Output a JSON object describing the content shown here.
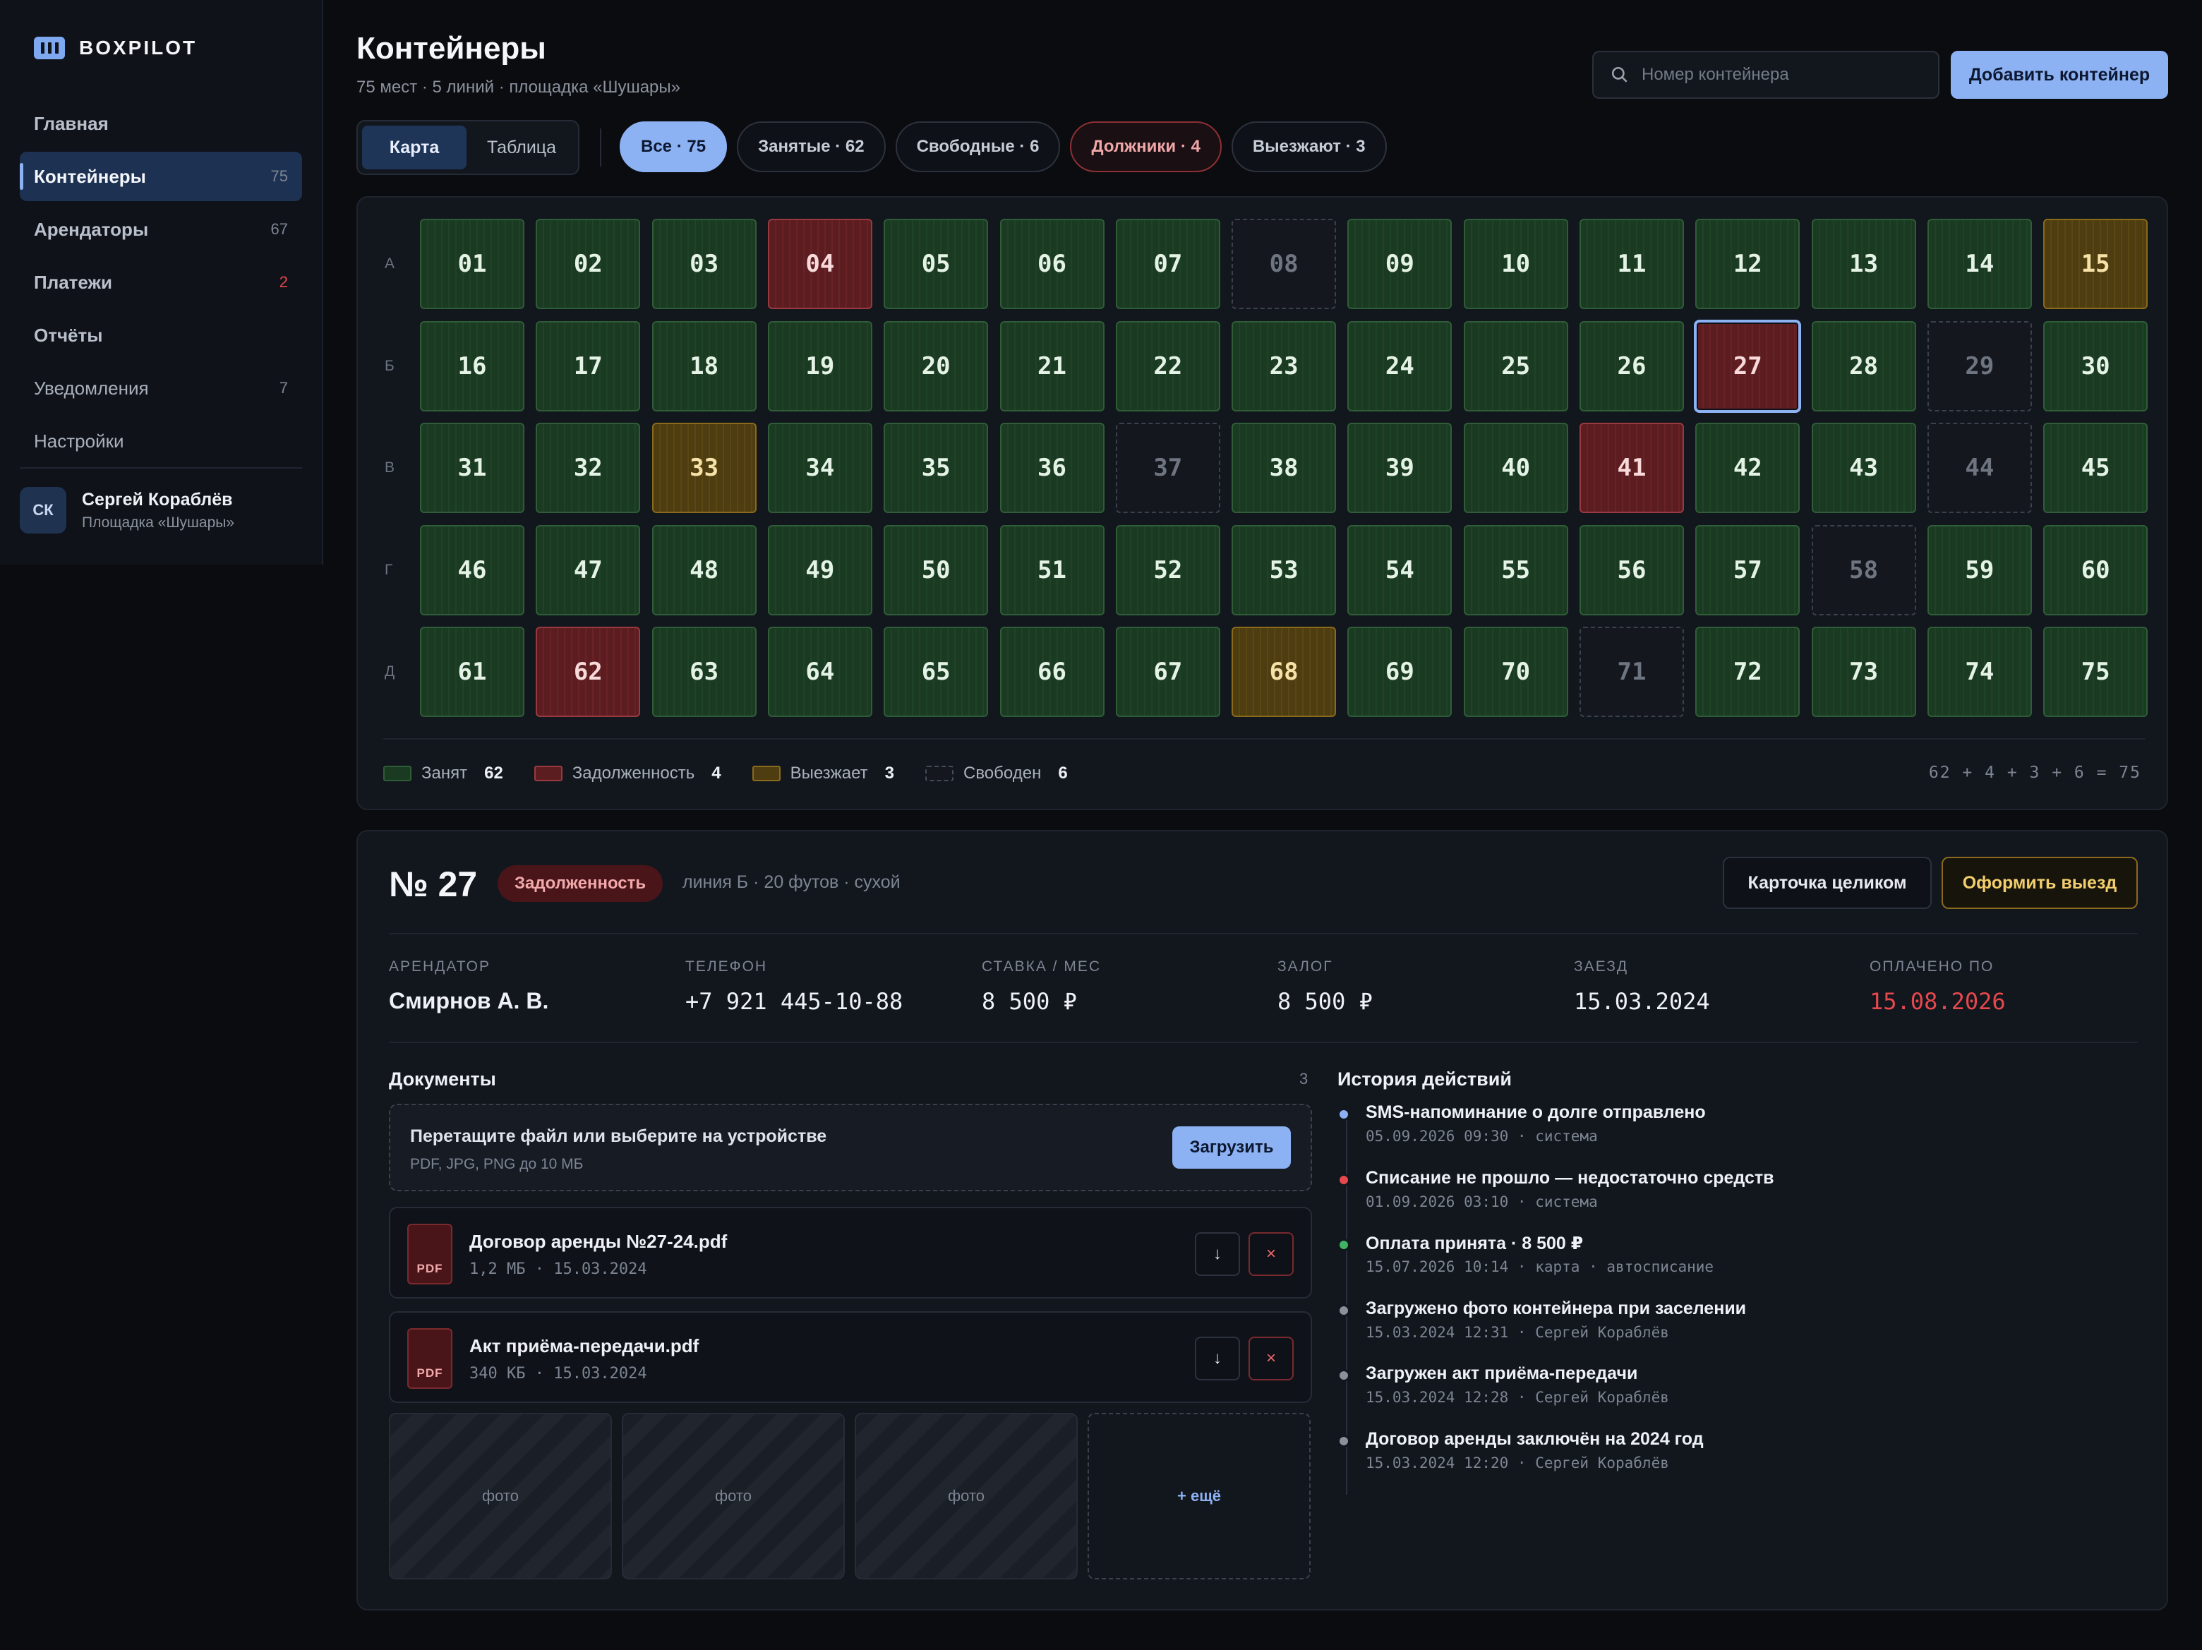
{
  "brand": {
    "name": "BOXPILOT"
  },
  "sidebar": {
    "items": [
      {
        "label": "Главная",
        "count": ""
      },
      {
        "label": "Контейнеры",
        "count": "75"
      },
      {
        "label": "Арендаторы",
        "count": "67"
      },
      {
        "label": "Платежи",
        "count": "2"
      },
      {
        "label": "Отчёты",
        "count": ""
      },
      {
        "label": "Уведомления",
        "count": "7"
      },
      {
        "label": "Настройки",
        "count": ""
      }
    ],
    "user": {
      "initials": "СК",
      "name": "Сергей Кораблёв",
      "site": "Площадка «Шушары»"
    }
  },
  "header": {
    "title": "Контейнеры",
    "subtitle": "75 мест · 5 линий · площадка «Шушары»",
    "search_placeholder": "Номер контейнера",
    "add_label": "Добавить контейнер"
  },
  "toolbar": {
    "view_map": "Карта",
    "view_table": "Таблица",
    "filters": [
      "Все · 75",
      "Занятые · 62",
      "Свободные · 6",
      "Должники · 4",
      "Выезжают · 3"
    ]
  },
  "map": {
    "rows": [
      {
        "label": "А",
        "cells": [
          [
            "01",
            "occ"
          ],
          [
            "02",
            "occ"
          ],
          [
            "03",
            "occ"
          ],
          [
            "04",
            "debt"
          ],
          [
            "05",
            "occ"
          ],
          [
            "06",
            "occ"
          ],
          [
            "07",
            "occ"
          ],
          [
            "08",
            "free"
          ],
          [
            "09",
            "occ"
          ],
          [
            "10",
            "occ"
          ],
          [
            "11",
            "occ"
          ],
          [
            "12",
            "occ"
          ],
          [
            "13",
            "occ"
          ],
          [
            "14",
            "occ"
          ],
          [
            "15",
            "leave"
          ]
        ]
      },
      {
        "label": "Б",
        "cells": [
          [
            "16",
            "occ"
          ],
          [
            "17",
            "occ"
          ],
          [
            "18",
            "occ"
          ],
          [
            "19",
            "occ"
          ],
          [
            "20",
            "occ"
          ],
          [
            "21",
            "occ"
          ],
          [
            "22",
            "occ"
          ],
          [
            "23",
            "occ"
          ],
          [
            "24",
            "occ"
          ],
          [
            "25",
            "occ"
          ],
          [
            "26",
            "occ"
          ],
          [
            "27",
            "debt"
          ],
          [
            "28",
            "occ"
          ],
          [
            "29",
            "free"
          ],
          [
            "30",
            "occ"
          ]
        ]
      },
      {
        "label": "В",
        "cells": [
          [
            "31",
            "occ"
          ],
          [
            "32",
            "occ"
          ],
          [
            "33",
            "leave"
          ],
          [
            "34",
            "occ"
          ],
          [
            "35",
            "occ"
          ],
          [
            "36",
            "occ"
          ],
          [
            "37",
            "free"
          ],
          [
            "38",
            "occ"
          ],
          [
            "39",
            "occ"
          ],
          [
            "40",
            "occ"
          ],
          [
            "41",
            "debt"
          ],
          [
            "42",
            "occ"
          ],
          [
            "43",
            "occ"
          ],
          [
            "44",
            "free"
          ],
          [
            "45",
            "occ"
          ]
        ]
      },
      {
        "label": "Г",
        "cells": [
          [
            "46",
            "occ"
          ],
          [
            "47",
            "occ"
          ],
          [
            "48",
            "occ"
          ],
          [
            "49",
            "occ"
          ],
          [
            "50",
            "occ"
          ],
          [
            "51",
            "occ"
          ],
          [
            "52",
            "occ"
          ],
          [
            "53",
            "occ"
          ],
          [
            "54",
            "occ"
          ],
          [
            "55",
            "occ"
          ],
          [
            "56",
            "occ"
          ],
          [
            "57",
            "occ"
          ],
          [
            "58",
            "free"
          ],
          [
            "59",
            "occ"
          ],
          [
            "60",
            "occ"
          ]
        ]
      },
      {
        "label": "Д",
        "cells": [
          [
            "61",
            "occ"
          ],
          [
            "62",
            "debt"
          ],
          [
            "63",
            "occ"
          ],
          [
            "64",
            "occ"
          ],
          [
            "65",
            "occ"
          ],
          [
            "66",
            "occ"
          ],
          [
            "67",
            "occ"
          ],
          [
            "68",
            "leave"
          ],
          [
            "69",
            "occ"
          ],
          [
            "70",
            "occ"
          ],
          [
            "71",
            "free"
          ],
          [
            "72",
            "occ"
          ],
          [
            "73",
            "occ"
          ],
          [
            "74",
            "occ"
          ],
          [
            "75",
            "occ"
          ]
        ]
      }
    ],
    "selected": "27",
    "legend": [
      {
        "label": "Занят",
        "count": "62",
        "kind": "occ"
      },
      {
        "label": "Задолженность",
        "count": "4",
        "kind": "debt"
      },
      {
        "label": "Выезжает",
        "count": "3",
        "kind": "leave"
      },
      {
        "label": "Свободен",
        "count": "6",
        "kind": "free"
      }
    ],
    "sum": "62 + 4 + 3 + 6 = 75"
  },
  "colors": {
    "accent": "#8db2f4",
    "occupied": "#1b3a22",
    "debt": "#5c1d21",
    "leaving": "#4e3d10",
    "danger": "#e5484d"
  },
  "detail": {
    "number": "№ 27",
    "status": "Задолженность",
    "meta": "линия Б · 20 футов · сухой",
    "btn_card": "Карточка целиком",
    "btn_exit": "Оформить выезд",
    "fields": [
      {
        "label": "АРЕНДАТОР",
        "value": "Смирнов А. В."
      },
      {
        "label": "ТЕЛЕФОН",
        "value": "+7 921 445-10-88"
      },
      {
        "label": "СТАВКА / МЕС",
        "value": "8 500 ₽"
      },
      {
        "label": "ЗАЛОГ",
        "value": "8 500 ₽"
      },
      {
        "label": "ЗАЕЗД",
        "value": "15.03.2024"
      },
      {
        "label": "ОПЛАЧЕНО ПО",
        "value": "15.08.2026"
      }
    ],
    "docs": {
      "title": "Документы",
      "count": "3",
      "drop_title": "Перетащите файл или выберите на устройстве",
      "drop_sub": "PDF, JPG, PNG до 10 МБ",
      "upload_label": "Загрузить",
      "files": [
        {
          "name": "Договор аренды №27-24.pdf",
          "meta": "1,2 МБ · 15.03.2024",
          "type": "PDF"
        },
        {
          "name": "Акт приёма-передачи.pdf",
          "meta": "340 КБ · 15.03.2024",
          "type": "PDF"
        }
      ],
      "photos": [
        "фото",
        "фото",
        "фото"
      ],
      "more_label": "+ ещё"
    },
    "history": {
      "title": "История действий",
      "events": [
        {
          "title": "SMS-напоминание о долге отправлено",
          "meta": "05.09.2026 09:30 · система",
          "color": "#8db2f4"
        },
        {
          "title": "Списание не прошло — недостаточно средств",
          "meta": "01.09.2026 03:10 · система",
          "color": "#e5484d"
        },
        {
          "title": "Оплата принята · 8 500 ₽",
          "meta": "15.07.2026 10:14 · карта · автосписание",
          "color": "#3fb463"
        },
        {
          "title": "Загружено фото контейнера при заселении",
          "meta": "15.03.2024 12:31 · Сергей Кораблёв",
          "color": "#8b919c"
        },
        {
          "title": "Загружен акт приёма-передачи",
          "meta": "15.03.2024 12:28 · Сергей Кораблёв",
          "color": "#8b919c"
        },
        {
          "title": "Договор аренды заключён на 2024 год",
          "meta": "15.03.2024 12:20 · Сергей Кораблёв",
          "color": "#8b919c"
        }
      ]
    }
  }
}
